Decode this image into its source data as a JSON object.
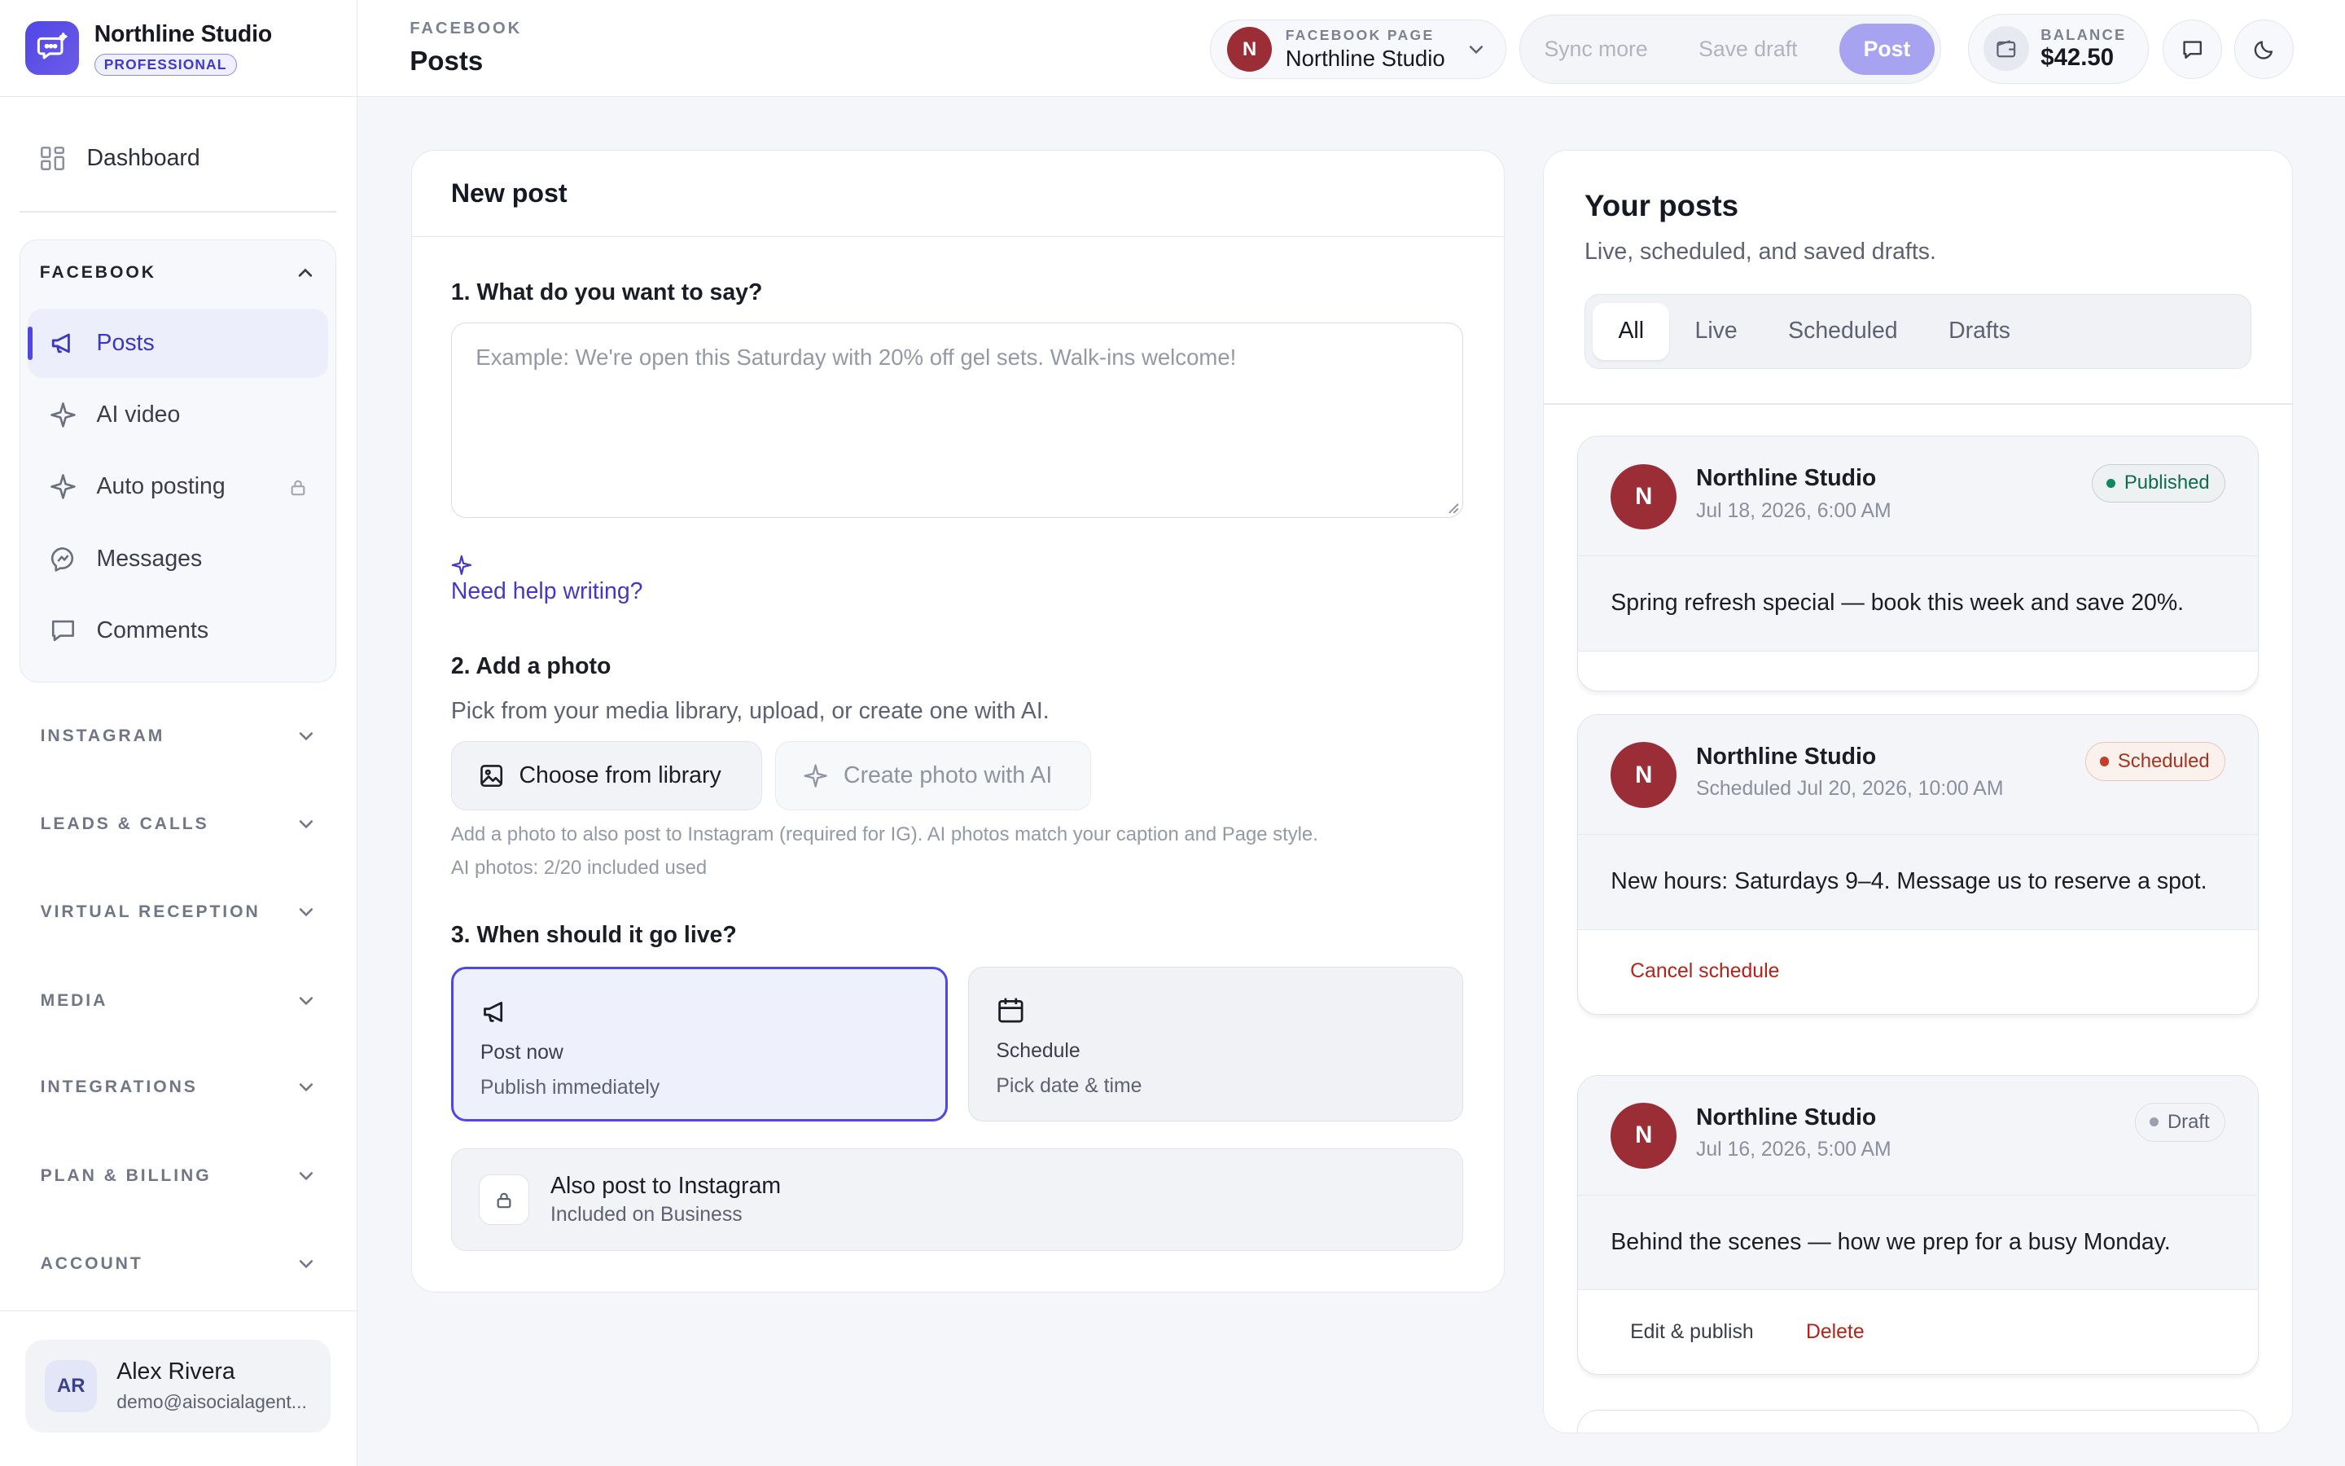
{
  "brand": {
    "name": "Northline Studio",
    "plan_badge": "PROFESSIONAL"
  },
  "sidebar": {
    "dashboard_label": "Dashboard",
    "facebook": {
      "label": "FACEBOOK",
      "items": [
        {
          "label": "Posts",
          "icon": "megaphone-icon",
          "active": true
        },
        {
          "label": "AI video",
          "icon": "sparkle-icon"
        },
        {
          "label": "Auto posting",
          "icon": "sparkle-icon",
          "locked": true
        },
        {
          "label": "Messages",
          "icon": "messenger-icon"
        },
        {
          "label": "Comments",
          "icon": "comment-icon"
        }
      ]
    },
    "sections": [
      {
        "label": "INSTAGRAM"
      },
      {
        "label": "LEADS & CALLS"
      },
      {
        "label": "VIRTUAL RECEPTION"
      },
      {
        "label": "MEDIA"
      },
      {
        "label": "INTEGRATIONS"
      },
      {
        "label": "PLAN & BILLING"
      },
      {
        "label": "ACCOUNT"
      }
    ]
  },
  "user": {
    "initials": "AR",
    "name": "Alex Rivera",
    "email": "demo@aisocialagent..."
  },
  "header": {
    "breadcrumb": "FACEBOOK",
    "title": "Posts",
    "page_selector": {
      "label": "FACEBOOK PAGE",
      "avatar": "N",
      "name": "Northline Studio"
    },
    "actions": {
      "sync": "Sync more",
      "save_draft": "Save draft",
      "post": "Post"
    },
    "balance": {
      "label": "BALANCE",
      "value": "$42.50"
    }
  },
  "new_post": {
    "title": "New post",
    "q1": "1. What do you want to say?",
    "placeholder": "Example: We're open this Saturday with 20% off gel sets. Walk-ins welcome!",
    "help_link": "Need help writing?",
    "q2": "2. Add a photo",
    "q2_sub": "Pick from your media library, upload, or create one with AI.",
    "choose_library": "Choose from library",
    "create_ai": "Create photo with AI",
    "hint1": "Add a photo to also post to Instagram (required for IG). AI photos match your caption and Page style.",
    "hint2": "AI photos: 2/20 included used",
    "q3": "3. When should it go live?",
    "post_now": {
      "title": "Post now",
      "sub": "Publish immediately"
    },
    "schedule": {
      "title": "Schedule",
      "sub": "Pick date & time"
    },
    "instagram": {
      "title": "Also post to Instagram",
      "sub": "Included on Business"
    }
  },
  "your_posts": {
    "title": "Your posts",
    "subtitle": "Live, scheduled, and saved drafts.",
    "tabs": [
      "All",
      "Live",
      "Scheduled",
      "Drafts"
    ],
    "active_tab": "All",
    "posts": [
      {
        "avatar": "N",
        "author": "Northline Studio",
        "date": "Jul 18, 2026, 6:00 AM",
        "status": "Published",
        "text": "Spring refresh special — book this week and save 20%."
      },
      {
        "avatar": "N",
        "author": "Northline Studio",
        "date": "Scheduled Jul 20, 2026, 10:00 AM",
        "status": "Scheduled",
        "text": "New hours: Saturdays 9–4. Message us to reserve a spot.",
        "action": "Cancel schedule"
      },
      {
        "avatar": "N",
        "author": "Northline Studio",
        "date": "Jul 16, 2026, 5:00 AM",
        "status": "Draft",
        "text": "Behind the scenes — how we prep for a busy Monday.",
        "actions": [
          "Edit & publish",
          "Delete"
        ]
      }
    ]
  },
  "colors": {
    "accent": "#4f46e5",
    "brand_avatar": "#9b2d36",
    "danger": "#b42318",
    "success": "#10865e"
  }
}
